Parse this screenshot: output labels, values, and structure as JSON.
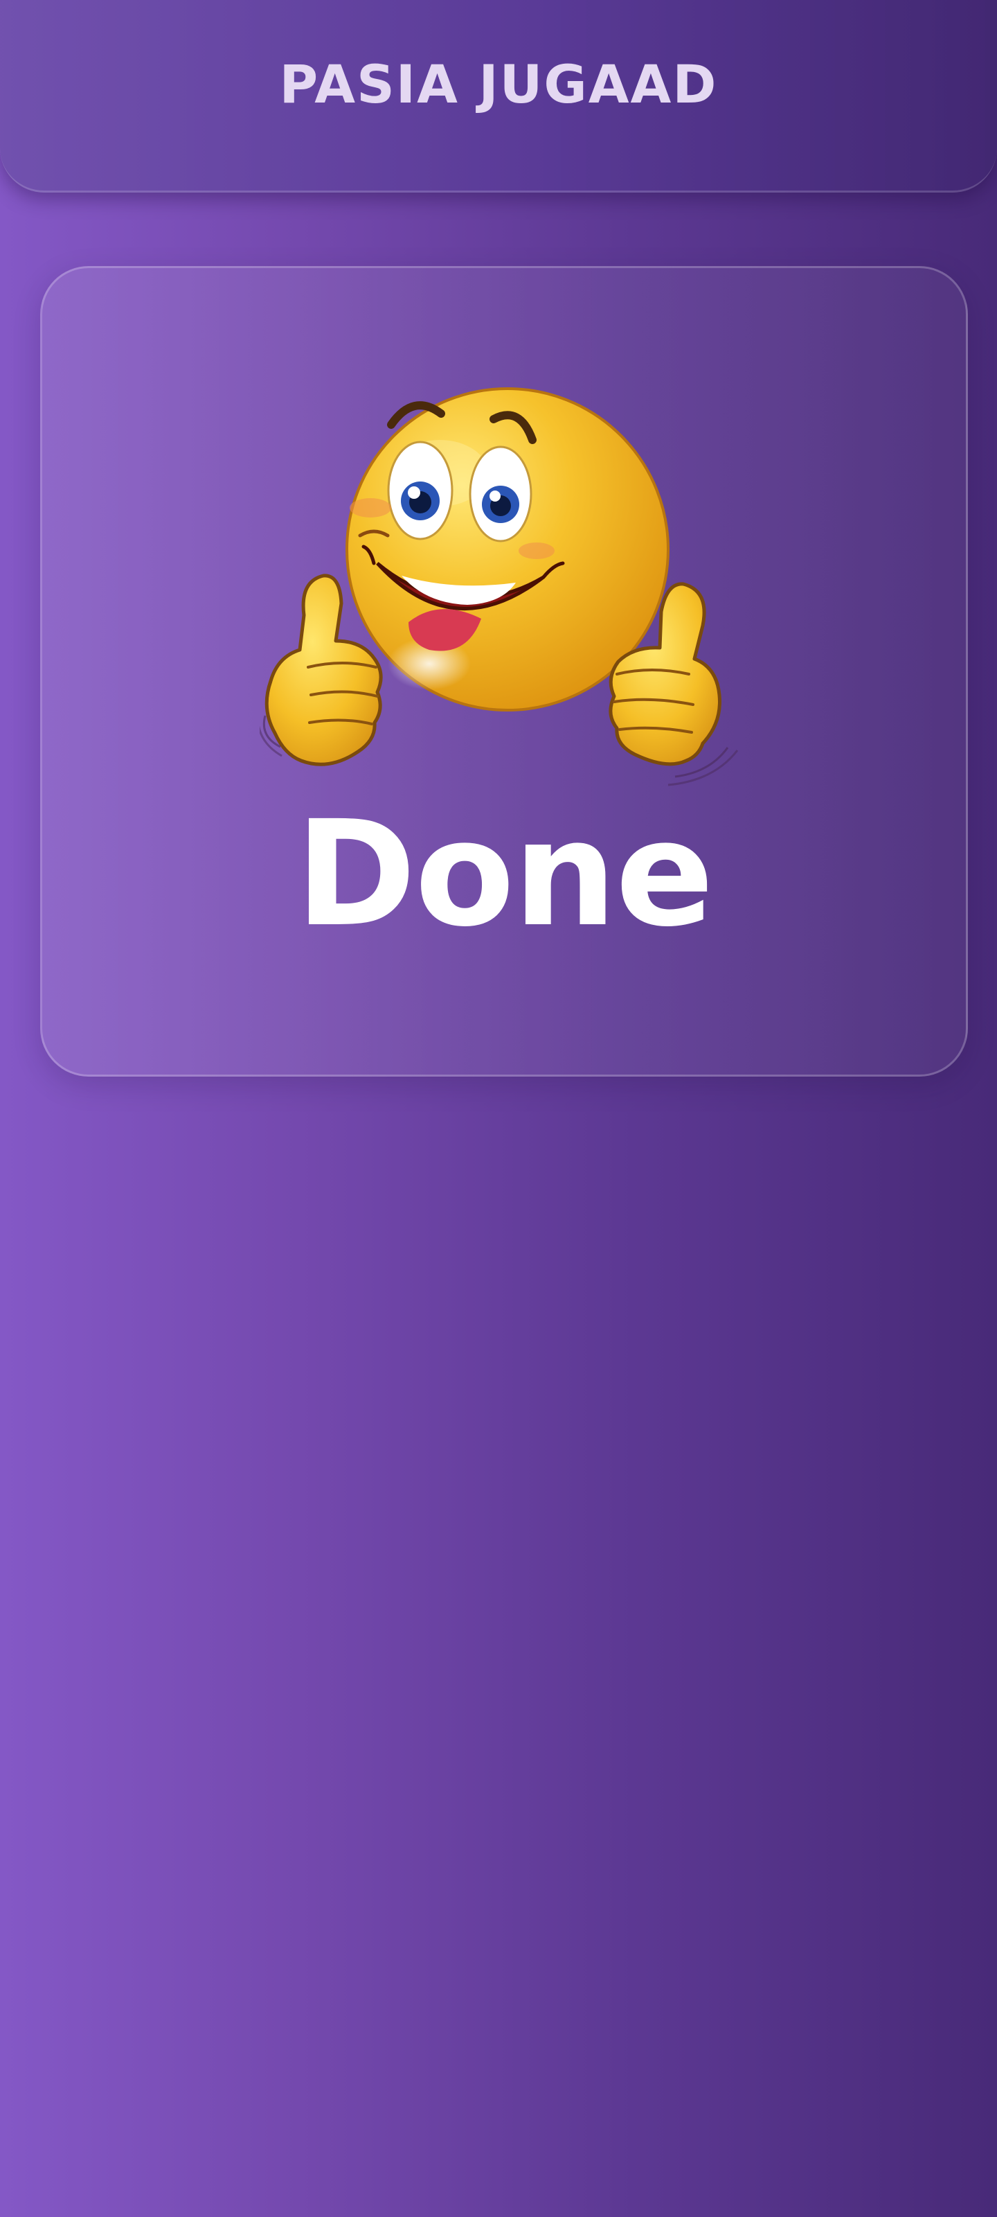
{
  "header": {
    "title": "PASIA JUGAAD"
  },
  "card": {
    "status_text": "Done",
    "illustration_icon": "thumbs-up-smiley-icon"
  },
  "colors": {
    "background_left": "#8458c6",
    "background_right": "#482a78",
    "title_text": "#e4d8f2",
    "status_text": "#ffffff",
    "emoji_face": "#f2b51c"
  }
}
